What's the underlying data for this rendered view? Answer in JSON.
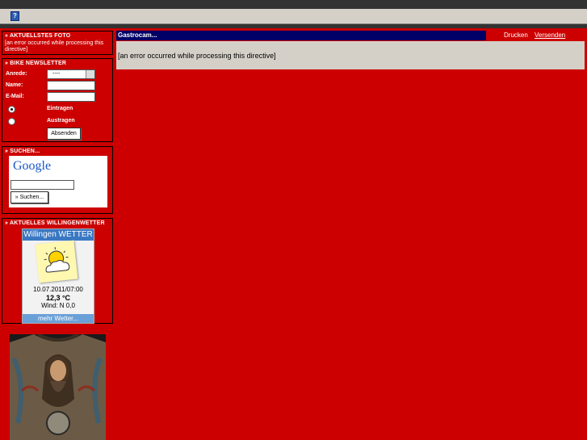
{
  "toolbar": {
    "help_icon": "?"
  },
  "sidebar": {
    "foto": {
      "title": "» AKTUELLSTES FOTO",
      "text": "[an error occurred while processing this directive]"
    },
    "newsletter": {
      "title": "» BIKE NEWSLETTER",
      "anrede_label": "Anrede:",
      "anrede_value": "----",
      "name_label": "Name:",
      "email_label": "E-Mail:",
      "eintragen_label": "Eintragen",
      "austragen_label": "Austragen",
      "submit_label": "Absenden"
    },
    "suchen": {
      "title": "» SUCHEN...",
      "google_logo": "Google",
      "search_button": "» Suchen..."
    },
    "wetter": {
      "title": "» AKTUELLES WILLINGENWETTER",
      "widget_title": "Willingen WETTER",
      "datetime": "10.07.2011/07:00",
      "temperature": "12,3 °C",
      "wind": "Wind: N 0,0",
      "more_link": "mehr Wetter...",
      "icon": "cloud-sun-icon"
    }
  },
  "main": {
    "title": "Gastrocam...",
    "print_link": "Drucken",
    "send_link": "Versenden",
    "content": "[an error occurred while processing this directive]"
  }
}
